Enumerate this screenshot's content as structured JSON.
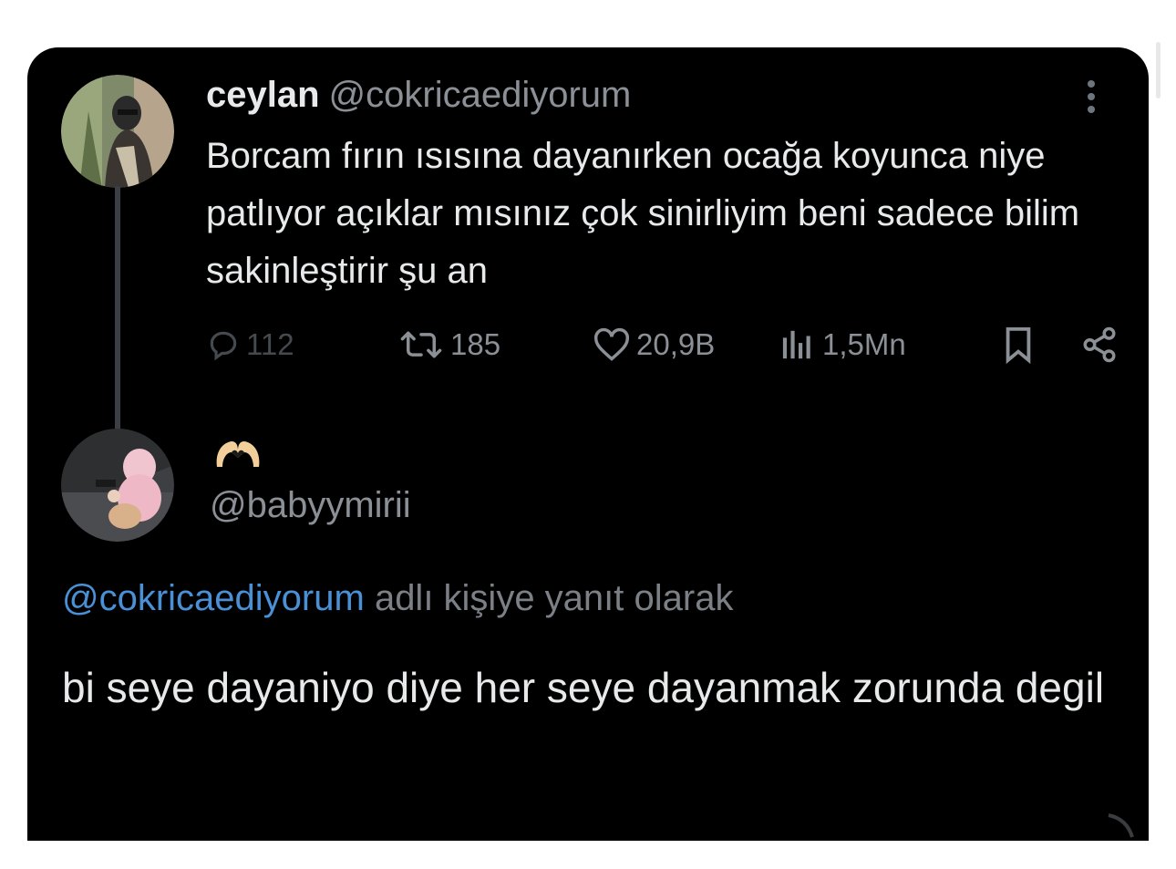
{
  "tweet": {
    "display_name": "ceylan",
    "handle": "@cokricaediyorum",
    "text": "Borcam fırın ısısına dayanırken ocağa koyunca niye patlıyor açıklar mısınız çok sinirliyim beni sadece bilim sakinleştirir şu an",
    "actions": {
      "replies": "112",
      "retweets": "185",
      "likes": "20,9B",
      "views": "1,5Mn"
    },
    "icons": [
      "more-icon",
      "reply-icon",
      "retweet-icon",
      "heart-icon",
      "views-icon",
      "bookmark-icon",
      "share-icon"
    ]
  },
  "reply": {
    "display_name_emoji": "heart-hands-emoji",
    "handle": "@babyymirii",
    "replying_to_mention": "@cokricaediyorum",
    "replying_to_suffix": " adlı kişiye yanıt olarak",
    "text": "bi seye dayaniyo diye her seye dayanmak zorunda degil"
  },
  "colors": {
    "background": "#000000",
    "text_primary": "#e7e9ea",
    "text_secondary": "#8b9096",
    "mention": "#4a90d6"
  }
}
